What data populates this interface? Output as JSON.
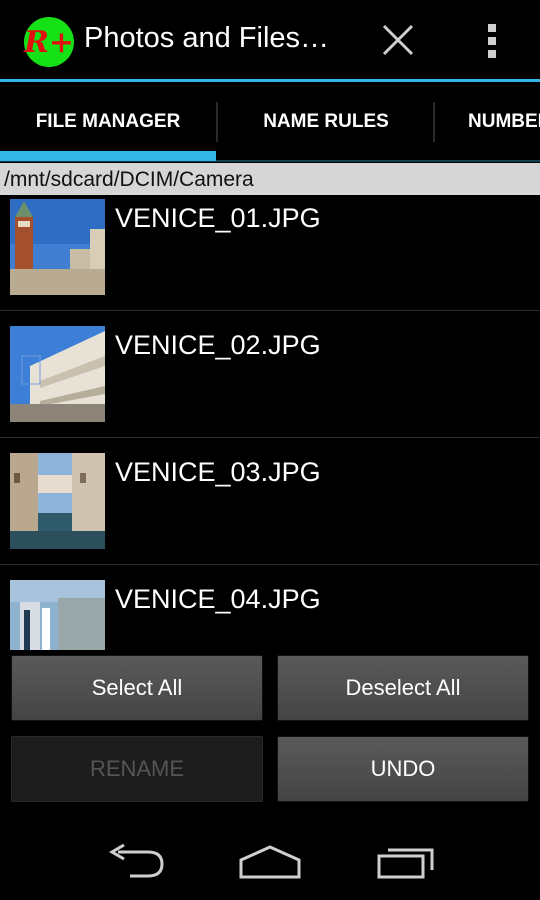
{
  "app": {
    "title": "Photos and Files…",
    "logo_text": "R+",
    "icons": {
      "close": "close-icon",
      "overflow": "overflow-menu-icon"
    }
  },
  "tabs": [
    {
      "label": "FILE MANAGER",
      "selected": true
    },
    {
      "label": "NAME RULES",
      "selected": false
    },
    {
      "label": "NUMBER",
      "selected": false
    }
  ],
  "path": "/mnt/sdcard/DCIM/Camera",
  "files": [
    {
      "name": "VENICE_01.JPG",
      "thumb": "venice-campanile-thumbnail"
    },
    {
      "name": "VENICE_02.JPG",
      "thumb": "venice-doges-palace-thumbnail"
    },
    {
      "name": "VENICE_03.JPG",
      "thumb": "venice-canal-bridge-thumbnail"
    },
    {
      "name": "VENICE_04.JPG",
      "thumb": "venice-gondola-thumbnail"
    }
  ],
  "buttons": {
    "select_all": "Select All",
    "deselect_all": "Deselect All",
    "rename": "RENAME",
    "undo": "UNDO"
  },
  "nav": {
    "back": "back-icon",
    "home": "home-icon",
    "recents": "recents-icon"
  },
  "colors": {
    "accent": "#33b5e5",
    "path_bg": "#d6d6d6",
    "button_bg": "#4e4e4e"
  }
}
